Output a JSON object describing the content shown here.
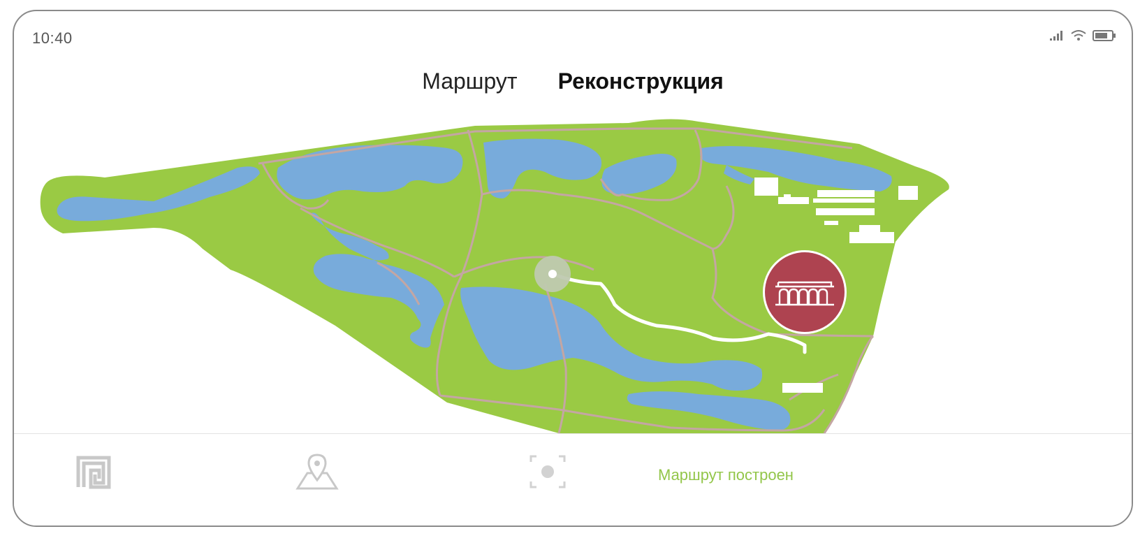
{
  "status_bar": {
    "time": "10:40"
  },
  "tabs": [
    {
      "label": "Маршрут",
      "active": false
    },
    {
      "label": "Реконструкция",
      "active": true
    }
  ],
  "map": {
    "colors": {
      "park": "#9aca44",
      "water": "#78abdb",
      "paths": "#c4a6a3",
      "route": "#ffffff",
      "marker": "#ae4350",
      "buildings": "#ffffff"
    },
    "icons": {
      "start_point": "location-dot-icon",
      "destination": "colonnade-building-icon"
    }
  },
  "bottom_nav": {
    "items": [
      {
        "icon": "meander-logo-icon"
      },
      {
        "icon": "map-pin-icon"
      },
      {
        "icon": "scan-target-icon"
      }
    ],
    "status_text": "Маршрут построен",
    "status_color": "#93c64a"
  }
}
